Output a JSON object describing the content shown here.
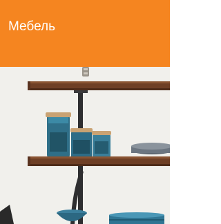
{
  "category_tile": {
    "title": "Мебель",
    "background_color": "#f58520",
    "title_color": "#ffffff",
    "image_description_icon": "kitchen-shelves-photo"
  }
}
